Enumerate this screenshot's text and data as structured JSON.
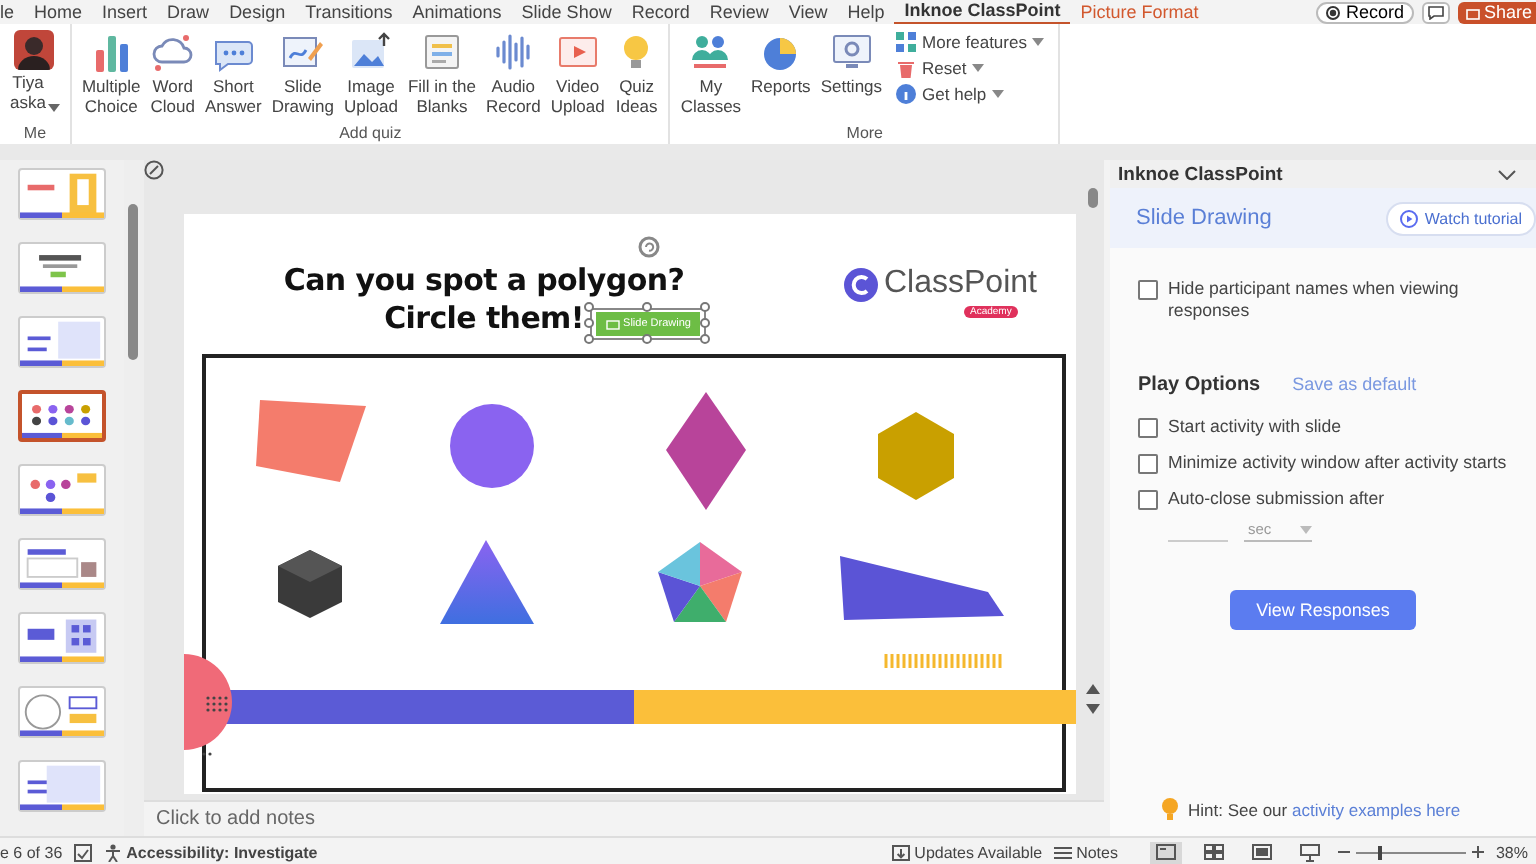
{
  "menu": {
    "tabs": [
      {
        "label": "le",
        "selected": false,
        "kind": "tab"
      },
      {
        "label": "Home",
        "selected": false,
        "kind": "tab"
      },
      {
        "label": "Insert",
        "selected": false,
        "kind": "tab"
      },
      {
        "label": "Draw",
        "selected": false,
        "kind": "tab"
      },
      {
        "label": "Design",
        "selected": false,
        "kind": "tab"
      },
      {
        "label": "Transitions",
        "selected": false,
        "kind": "tab"
      },
      {
        "label": "Animations",
        "selected": false,
        "kind": "tab"
      },
      {
        "label": "Slide Show",
        "selected": false,
        "kind": "tab"
      },
      {
        "label": "Record",
        "selected": false,
        "kind": "tab"
      },
      {
        "label": "Review",
        "selected": false,
        "kind": "tab"
      },
      {
        "label": "View",
        "selected": false,
        "kind": "tab"
      },
      {
        "label": "Help",
        "selected": false,
        "kind": "tab"
      },
      {
        "label": "Inknoe ClassPoint",
        "selected": true,
        "kind": "tab"
      },
      {
        "label": "Picture Format",
        "selected": false,
        "kind": "contextual"
      }
    ],
    "record": "Record",
    "share": "Share"
  },
  "ribbon": {
    "groups": [
      {
        "label": "Me",
        "kind": "user",
        "user": "Tiya\naska"
      },
      {
        "label": "Add quiz",
        "kind": "buttons",
        "items": [
          {
            "label": "Multiple\nChoice"
          },
          {
            "label": "Word\nCloud"
          },
          {
            "label": "Short\nAnswer"
          },
          {
            "label": "Slide\nDrawing"
          },
          {
            "label": "Image\nUpload"
          },
          {
            "label": "Fill in the\nBlanks"
          },
          {
            "label": "Audio\nRecord"
          },
          {
            "label": "Video\nUpload"
          },
          {
            "label": "Quiz\nIdeas"
          }
        ]
      },
      {
        "label": "More",
        "kind": "buttons",
        "items": [
          {
            "label": "My\nClasses"
          },
          {
            "label": "Reports"
          },
          {
            "label": "Settings"
          }
        ],
        "menu": [
          {
            "label": "More features"
          },
          {
            "label": "Reset"
          },
          {
            "label": "Get help"
          }
        ]
      }
    ]
  },
  "thumbnails": [
    {
      "selected": false
    },
    {
      "selected": false
    },
    {
      "selected": false
    },
    {
      "selected": true
    },
    {
      "selected": false
    },
    {
      "selected": false
    },
    {
      "selected": false
    },
    {
      "selected": false
    },
    {
      "selected": false
    }
  ],
  "slide": {
    "title_lines": [
      "Can you spot a polygon?",
      "Circle them!"
    ],
    "logo": "ClassPoint",
    "logo_badge": "Academy",
    "drawing_button": {
      "label": "Slide Drawing",
      "selected": true
    }
  },
  "notes": {
    "placeholder": "Click to add notes"
  },
  "pane": {
    "title": "Inknoe ClassPoint",
    "activity": "Slide Drawing",
    "tutorial": "Watch tutorial",
    "options": [
      {
        "label": "Hide participant names when viewing responses",
        "checked": false
      }
    ],
    "play_heading": "Play Options",
    "save_default": "Save as default",
    "play_options": [
      {
        "label": "Start activity with slide",
        "checked": false
      },
      {
        "label": "Minimize activity window after activity starts",
        "checked": false
      },
      {
        "label": "Auto-close submission after",
        "checked": false
      }
    ],
    "timer": {
      "unit": "sec"
    },
    "view_button": "View Responses",
    "hint": {
      "text": "Hint: See our",
      "link": "activity examples here"
    }
  },
  "status": {
    "slide": "e 6 of 36",
    "accessibility": "Accessibility: Investigate",
    "updates": "Updates Available",
    "notes": "Notes",
    "views": [
      {
        "selected": true
      },
      {
        "selected": false
      },
      {
        "selected": false
      },
      {
        "selected": false
      }
    ],
    "zoom": {
      "level": 0.2,
      "reading": "38%"
    }
  }
}
